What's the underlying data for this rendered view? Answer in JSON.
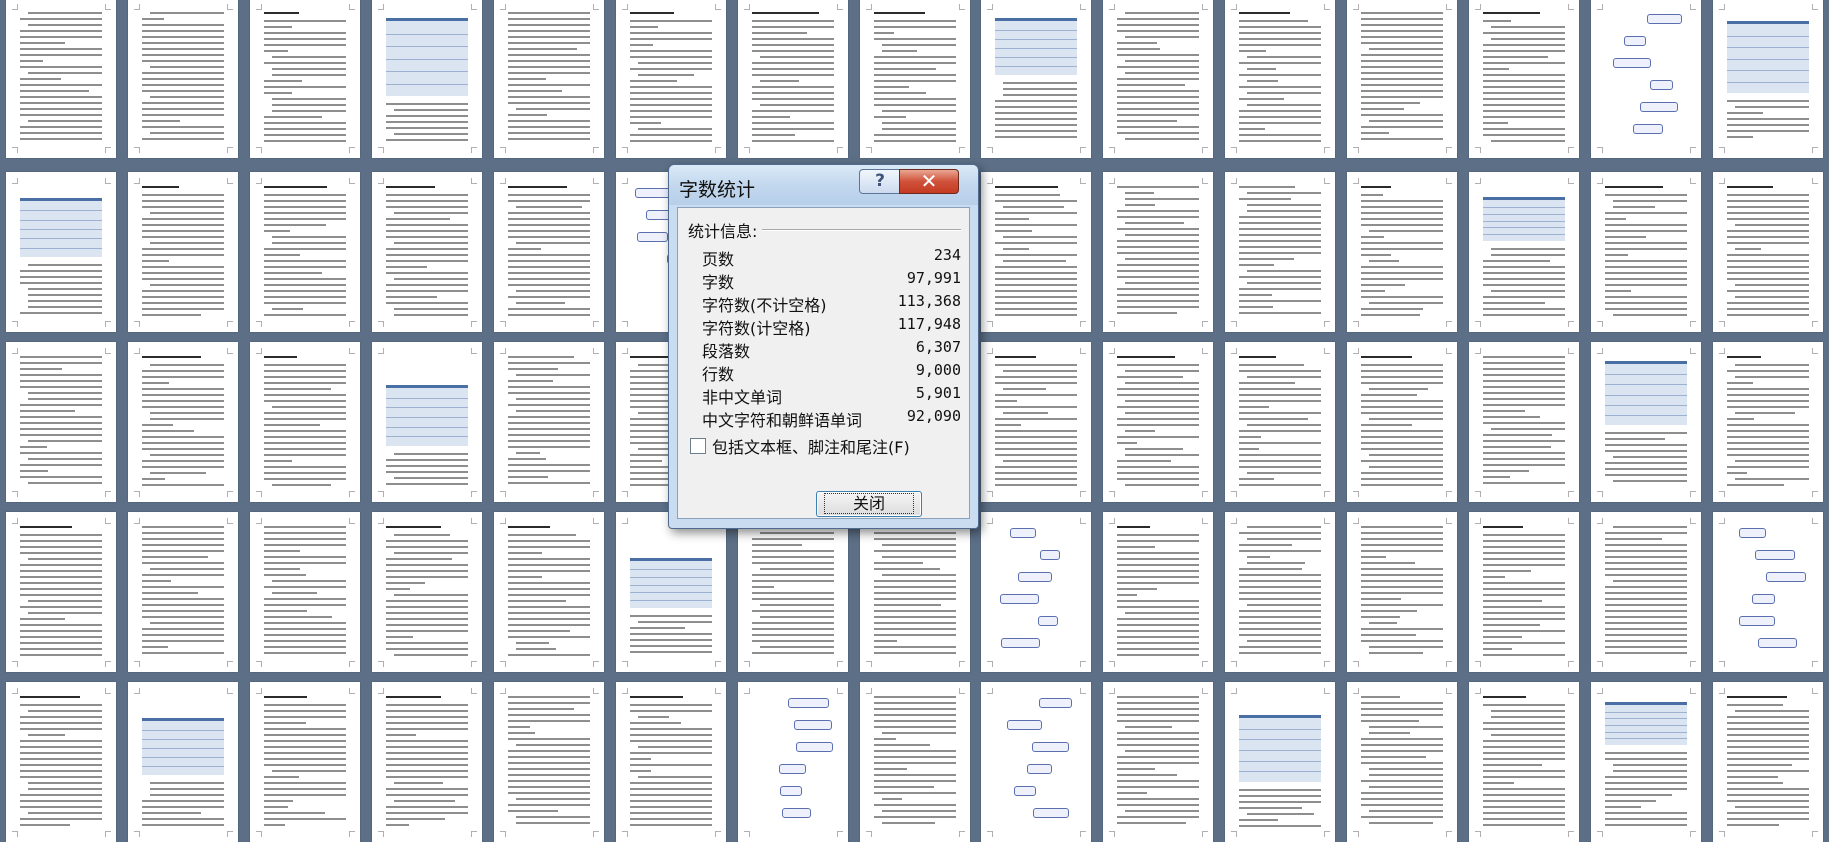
{
  "dialog": {
    "title": "字数统计",
    "help_button": "?",
    "close_x": "✕",
    "stats_header": "统计信息:",
    "stats": [
      {
        "label": "页数",
        "value": "234"
      },
      {
        "label": "字数",
        "value": "97,991"
      },
      {
        "label": "字符数(不计空格)",
        "value": "113,368"
      },
      {
        "label": "字符数(计空格)",
        "value": "117,948"
      },
      {
        "label": "段落数",
        "value": "6,307"
      },
      {
        "label": "行数",
        "value": "9,000"
      },
      {
        "label": "非中文单词",
        "value": "5,901"
      },
      {
        "label": "中文字符和朝鲜语单词",
        "value": "92,090"
      }
    ],
    "include_label": "包括文本框、脚注和尾注(F)",
    "include_checked": false,
    "close_label": "关闭"
  },
  "background": {
    "description_icon": "document-page-thumbnails",
    "color": "#5c6f86"
  }
}
